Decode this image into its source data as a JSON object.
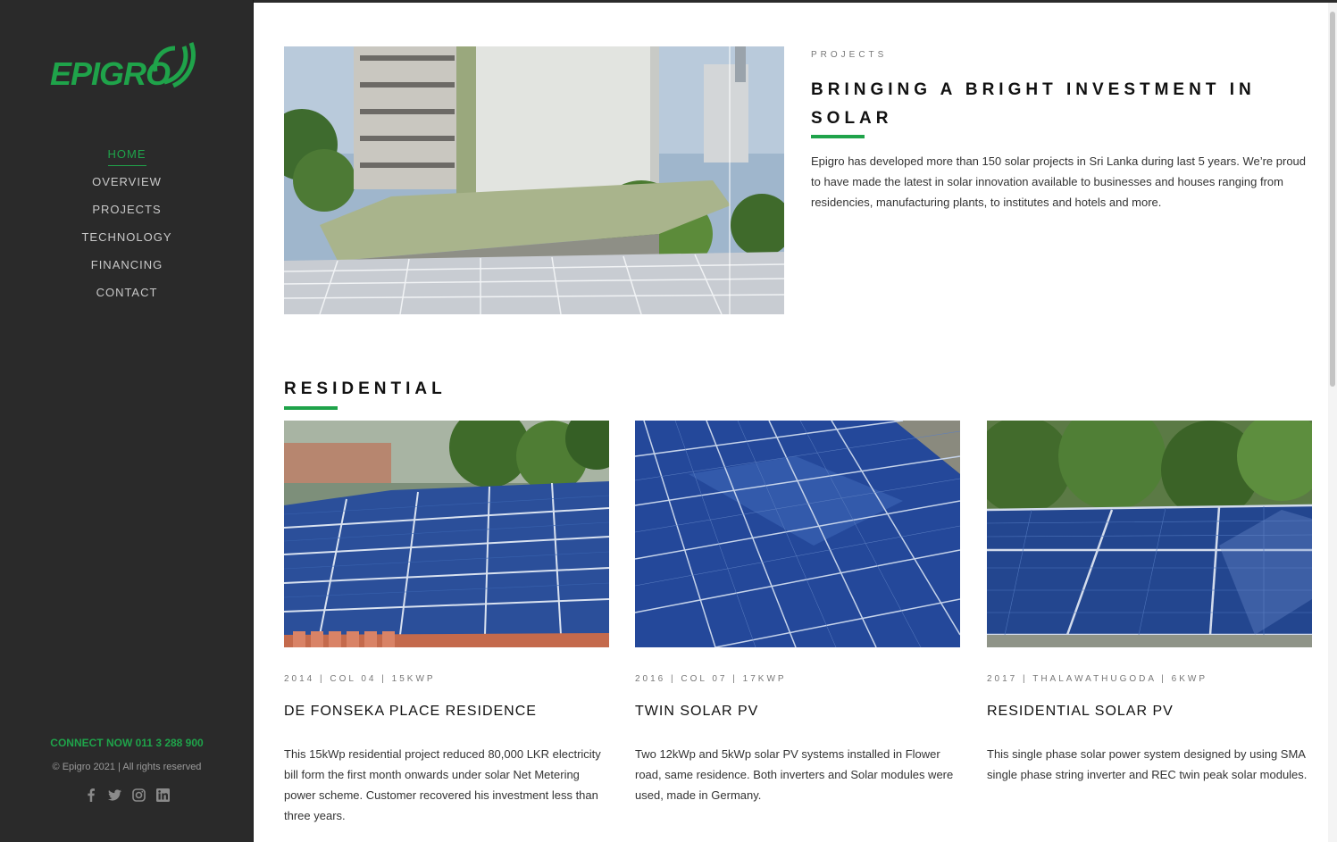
{
  "brand": {
    "logo_text": "EPIGRO",
    "accent_color": "#1fa34a",
    "sidebar_color": "#2a2a2a"
  },
  "nav": {
    "items": [
      {
        "label": "HOME",
        "active": true
      },
      {
        "label": "OVERVIEW",
        "active": false
      },
      {
        "label": "PROJECTS",
        "active": false
      },
      {
        "label": "TECHNOLOGY",
        "active": false
      },
      {
        "label": "FINANCING",
        "active": false
      },
      {
        "label": "CONTACT",
        "active": false
      }
    ]
  },
  "sidebar_footer": {
    "connect": "CONNECT NOW 011 3 288 900",
    "copyright": "© Epigro 2021 | All rights reserved",
    "social_icons": [
      "facebook-icon",
      "twitter-icon",
      "instagram-icon",
      "linkedin-icon"
    ]
  },
  "hero": {
    "kicker": "PROJECTS",
    "title": "BRINGING A BRIGHT INVESTMENT IN SOLAR",
    "description": "Epigro has developed more than 150 solar projects in Sri Lanka during last 5 years. We’re proud to have made the latest in solar innovation available to businesses and houses ranging from residencies, manufacturing plants, to institutes and hotels and more."
  },
  "residential": {
    "title": "RESIDENTIAL",
    "projects": [
      {
        "meta": "2014 | COL 04 | 15KWP",
        "name": "DE FONSEKA PLACE RESIDENCE",
        "description": "This 15kWp residential project reduced 80,000 LKR electricity bill form the first month onwards under solar Net Metering power scheme. Customer recovered his investment less than three years."
      },
      {
        "meta": "2016 | COL 07 | 17KWP",
        "name": "TWIN SOLAR PV",
        "description": "Two 12kWp and 5kWp solar PV systems installed in Flower road, same residence. Both inverters and Solar modules were used, made in Germany."
      },
      {
        "meta": "2017 | THALAWATHUGODA | 6KWP",
        "name": "RESIDENTIAL SOLAR PV",
        "description": "This single phase solar power system designed by using SMA single phase string inverter and REC twin peak solar modules."
      }
    ]
  }
}
